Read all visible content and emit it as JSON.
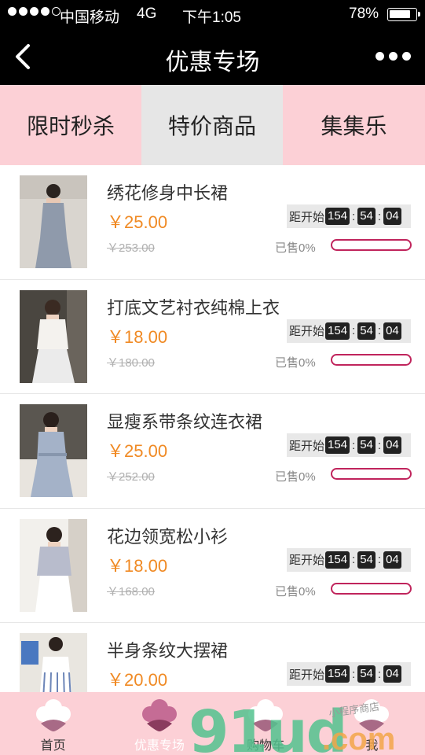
{
  "status_bar": {
    "carrier": "中国移动",
    "network": "4G",
    "time": "下午1:05",
    "battery": "78%"
  },
  "nav": {
    "title": "优惠专场"
  },
  "tabs": [
    {
      "label": "限时秒杀",
      "active": false
    },
    {
      "label": "特价商品",
      "active": true
    },
    {
      "label": "集集乐",
      "active": false
    }
  ],
  "countdown_label": "距开始",
  "products": [
    {
      "name": "绣花修身中长裙",
      "price": "￥25.00",
      "original_price": "￥253.00",
      "countdown": [
        "154",
        "54",
        "04"
      ],
      "sold": "已售0%",
      "sold_fraction": 0
    },
    {
      "name": "打底文艺衬衣纯棉上衣",
      "price": "￥18.00",
      "original_price": "￥180.00",
      "countdown": [
        "154",
        "54",
        "04"
      ],
      "sold": "已售0%",
      "sold_fraction": 0
    },
    {
      "name": "显瘦系带条纹连衣裙",
      "price": "￥25.00",
      "original_price": "￥252.00",
      "countdown": [
        "154",
        "54",
        "04"
      ],
      "sold": "已售0%",
      "sold_fraction": 0
    },
    {
      "name": "花边领宽松小衫",
      "price": "￥18.00",
      "original_price": "￥168.00",
      "countdown": [
        "154",
        "54",
        "04"
      ],
      "sold": "已售0%",
      "sold_fraction": 0
    },
    {
      "name": "半身条纹大摆裙",
      "price": "￥20.00",
      "original_price": "",
      "countdown": [
        "154",
        "54",
        "04"
      ],
      "sold": "",
      "sold_fraction": 0
    }
  ],
  "tabbar": [
    {
      "label": "首页",
      "icon": "cotton-flower-icon",
      "active": false
    },
    {
      "label": "优惠专场",
      "icon": "cotton-flower-icon",
      "active": true
    },
    {
      "label": "购物车",
      "icon": "cotton-flower-icon",
      "active": false
    },
    {
      "label": "我",
      "icon": "cotton-flower-icon",
      "active": false
    }
  ],
  "watermark": {
    "brand": "91ud",
    "suffix": ".com",
    "tagline": "小程序商店"
  },
  "colors": {
    "nav_background": "#000000",
    "tab_background": "#fcd0d6",
    "tab_active": "#e6e6e6",
    "price": "#f08a24",
    "progress": "#c0245c"
  }
}
